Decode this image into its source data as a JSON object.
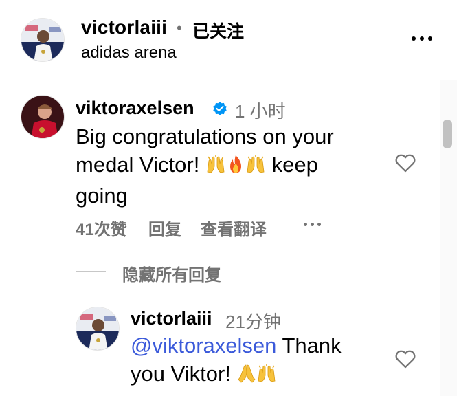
{
  "header": {
    "username": "victorlaiii",
    "separator": "•",
    "follow_status": "已关注",
    "location": "adidas arena"
  },
  "comment": {
    "username": "viktoraxelsen",
    "time": "1 小时",
    "text_line1": "Big congratulations on your",
    "text_line2": "medal Victor!",
    "text_line2_suffix": "keep",
    "text_line3": "going",
    "emojis": [
      "raising-hands",
      "fire",
      "raising-hands"
    ],
    "likes": "41次赞",
    "reply_label": "回复",
    "translate_label": "查看翻译",
    "hide_replies": "隐藏所有回复"
  },
  "reply": {
    "username": "victorlaiii",
    "time": "21分钟",
    "mention": "@viktoraxelsen",
    "text_after_mention": "Thank",
    "text_line2": "you Viktor!",
    "emojis": [
      "folded-hands",
      "raising-hands"
    ]
  },
  "colors": {
    "secondary_text": "#737373",
    "mention": "#3b5ada",
    "verified": "#0095f6"
  }
}
